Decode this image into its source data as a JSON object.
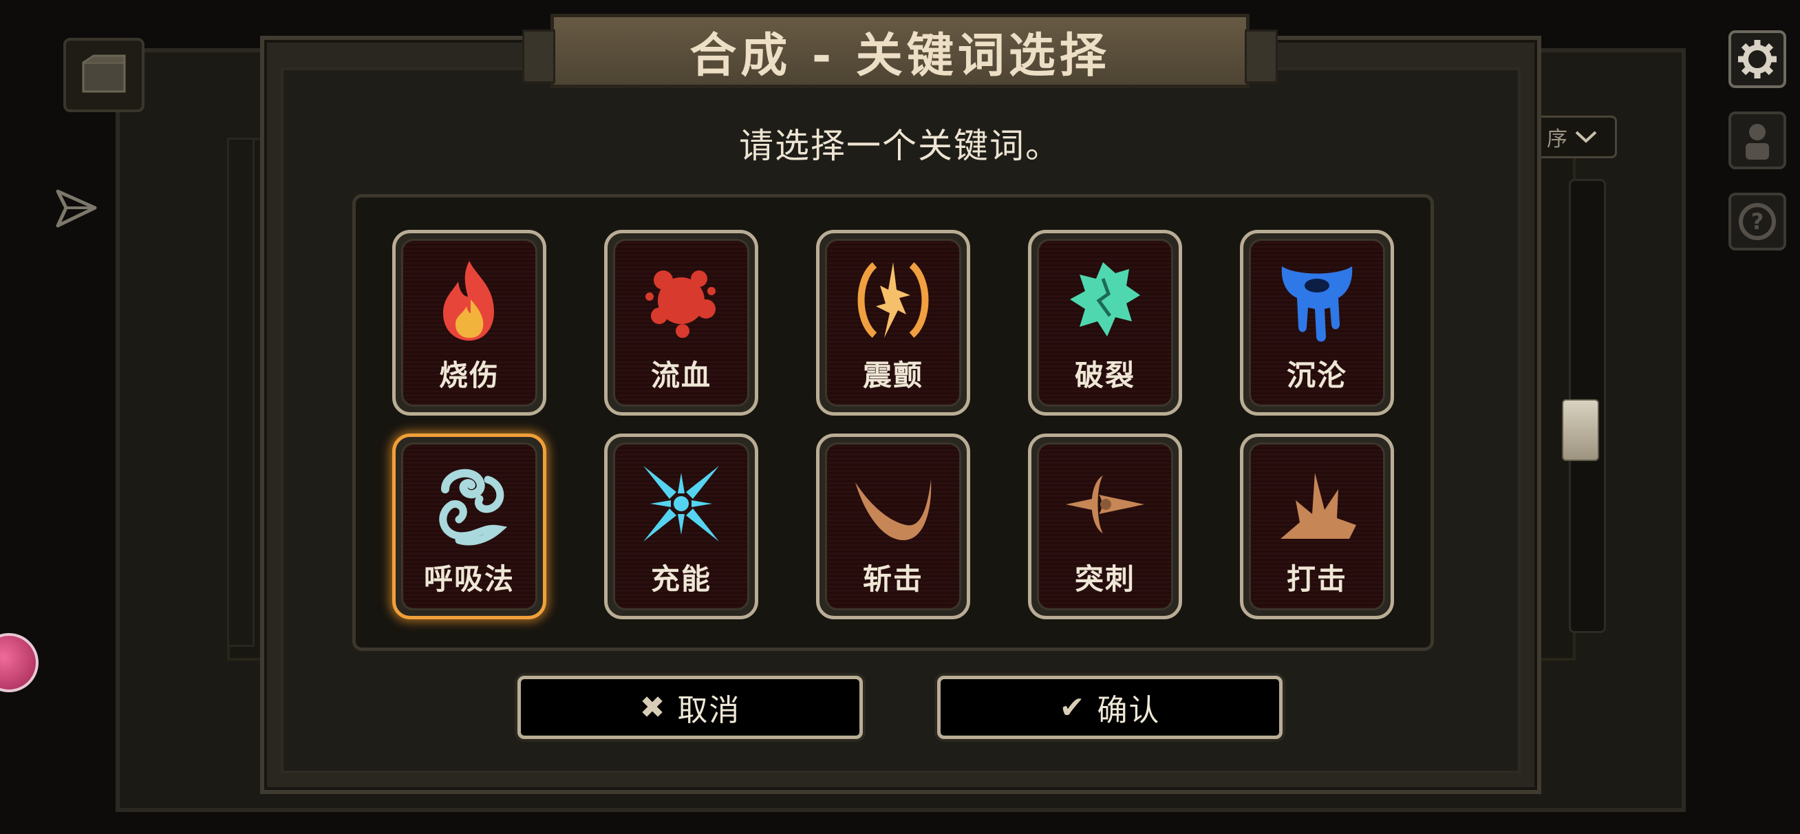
{
  "dialog": {
    "title": "合成 - 关键词选择",
    "prompt": "请选择一个关键词。"
  },
  "keywords": [
    {
      "label": "烧伤",
      "icon": "flame-icon",
      "color": "#e8453a",
      "selected": false
    },
    {
      "label": "流血",
      "icon": "blood-splatter-icon",
      "color": "#d83a2e",
      "selected": false
    },
    {
      "label": "震颤",
      "icon": "tremor-icon",
      "color": "#f0a040",
      "selected": false
    },
    {
      "label": "破裂",
      "icon": "rupture-icon",
      "color": "#4fd8b0",
      "selected": false
    },
    {
      "label": "沉沦",
      "icon": "sinking-icon",
      "color": "#2f78e8",
      "selected": false
    },
    {
      "label": "呼吸法",
      "icon": "breath-swirl-icon",
      "color": "#a9d9dc",
      "selected": true
    },
    {
      "label": "充能",
      "icon": "charge-icon",
      "color": "#54d4f0",
      "selected": false
    },
    {
      "label": "斩击",
      "icon": "slash-icon",
      "color": "#c68656",
      "selected": false
    },
    {
      "label": "突刺",
      "icon": "pierce-icon",
      "color": "#c68656",
      "selected": false
    },
    {
      "label": "打击",
      "icon": "blunt-icon",
      "color": "#c68656",
      "selected": false
    }
  ],
  "buttons": {
    "cancel_label": "取消",
    "confirm_label": "确认"
  },
  "background": {
    "sort_label": "序"
  },
  "colors": {
    "selected_border": "#f0a03a",
    "tile_border": "#b9ad95"
  }
}
